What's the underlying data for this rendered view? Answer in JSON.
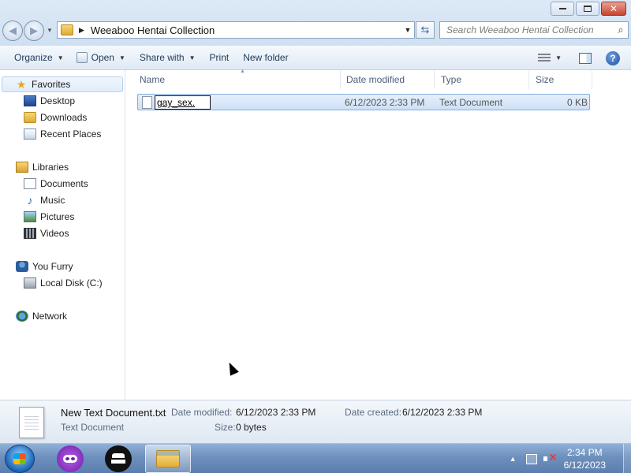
{
  "window": {
    "address": "Weeaboo Hentai Collection",
    "search_placeholder": "Search Weeaboo Hentai Collection"
  },
  "toolbar": {
    "organize": "Organize",
    "open": "Open",
    "share_with": "Share with",
    "print": "Print",
    "new_folder": "New folder"
  },
  "sidebar": {
    "favorites": "Favorites",
    "desktop": "Desktop",
    "downloads": "Downloads",
    "recent_places": "Recent Places",
    "libraries": "Libraries",
    "documents": "Documents",
    "music": "Music",
    "pictures": "Pictures",
    "videos": "Videos",
    "user": "You Furry",
    "local_disk": "Local Disk (C:)",
    "network": "Network"
  },
  "columns": {
    "name": "Name",
    "date_modified": "Date modified",
    "type": "Type",
    "size": "Size"
  },
  "file": {
    "rename_value": "gay_sex.",
    "date_modified": "6/12/2023 2:33 PM",
    "type": "Text Document",
    "size": "0 KB"
  },
  "details": {
    "filename": "New Text Document.txt",
    "filetype": "Text Document",
    "date_modified_label": "Date modified:",
    "date_modified": "6/12/2023 2:33 PM",
    "date_created_label": "Date created:",
    "date_created": "6/12/2023 2:33 PM",
    "size_label": "Size:",
    "size": "0 bytes"
  },
  "taskbar": {
    "time": "2:34 PM",
    "date": "6/12/2023"
  },
  "colors": {
    "selection": "#cde0f7",
    "toolbar_text": "#1e395b",
    "taskbar": "#6e90bd"
  }
}
